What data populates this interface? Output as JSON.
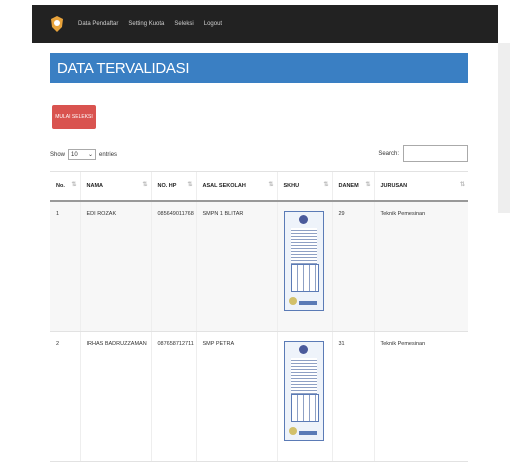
{
  "nav": {
    "items": [
      "Data Pendaftar",
      "Setting Kuota",
      "Seleksi",
      "Logout"
    ]
  },
  "page_title": "DATA TERVALIDASI",
  "mulai_button_label": "MULAI SELEKSI",
  "controls": {
    "show_label": "Show",
    "show_value": "10",
    "entries_label": "entries",
    "search_label": "Search:",
    "search_value": ""
  },
  "table": {
    "headers": [
      "No.",
      "NAMA",
      "NO. HP",
      "ASAL SEKOLAH",
      "SKHU",
      "DANEM",
      "JURUSAN"
    ],
    "rows": [
      {
        "no": "1",
        "nama": "EDI ROZAK",
        "hp": "085649011768",
        "sekolah": "SMPN 1 BLITAR",
        "danem": "29",
        "jurusan": "Teknik Pemesinan"
      },
      {
        "no": "2",
        "nama": "IRHAS BADRUZZAMAN",
        "hp": "087658712711",
        "sekolah": "SMP PETRA",
        "danem": "31",
        "jurusan": "Teknik Pemesinan"
      }
    ]
  },
  "colors": {
    "nav_bg": "#222222",
    "title_bg": "#3a7fc3",
    "button_bg": "#d9534f"
  }
}
